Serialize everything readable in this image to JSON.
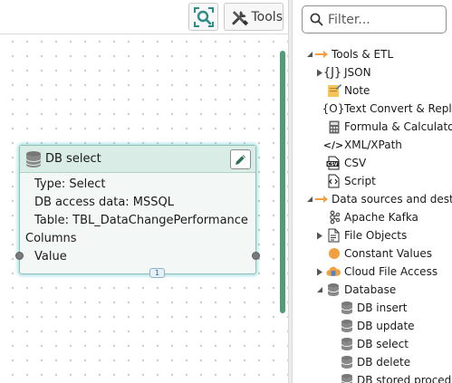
{
  "canvas": {
    "toolbar": {
      "tools_label": "Tools"
    },
    "node": {
      "title": "DB select",
      "lines": {
        "type": "Type: Select",
        "access": "DB access data: MSSQL",
        "table": "Table: TBL_DataChangePerformance",
        "columns": "Columns",
        "value": "Value"
      },
      "badge": "1"
    }
  },
  "panel": {
    "filter_placeholder": "Filter...",
    "tree": {
      "tools_etl": "Tools & ETL",
      "json": "JSON",
      "note": "Note",
      "text_convert": "Text Convert & Repl",
      "formula": "Formula & Calculato",
      "xml": "XML/XPath",
      "csv": "CSV",
      "script": "Script",
      "data_sources": "Data sources and dest",
      "kafka": "Apache Kafka",
      "file_objects": "File Objects",
      "constant_values": "Constant Values",
      "cloud_file_access": "Cloud File Access",
      "database": "Database",
      "db_insert": "DB insert",
      "db_update": "DB update",
      "db_select": "DB select",
      "db_delete": "DB delete",
      "db_stored": "DB stored proced"
    }
  },
  "colors": {
    "accent_teal": "#2e8b88",
    "arrow_orange": "#f0a040",
    "scroll_green": "#4e9d77",
    "node_header": "#d9ece5",
    "db_icon": "#777777"
  }
}
